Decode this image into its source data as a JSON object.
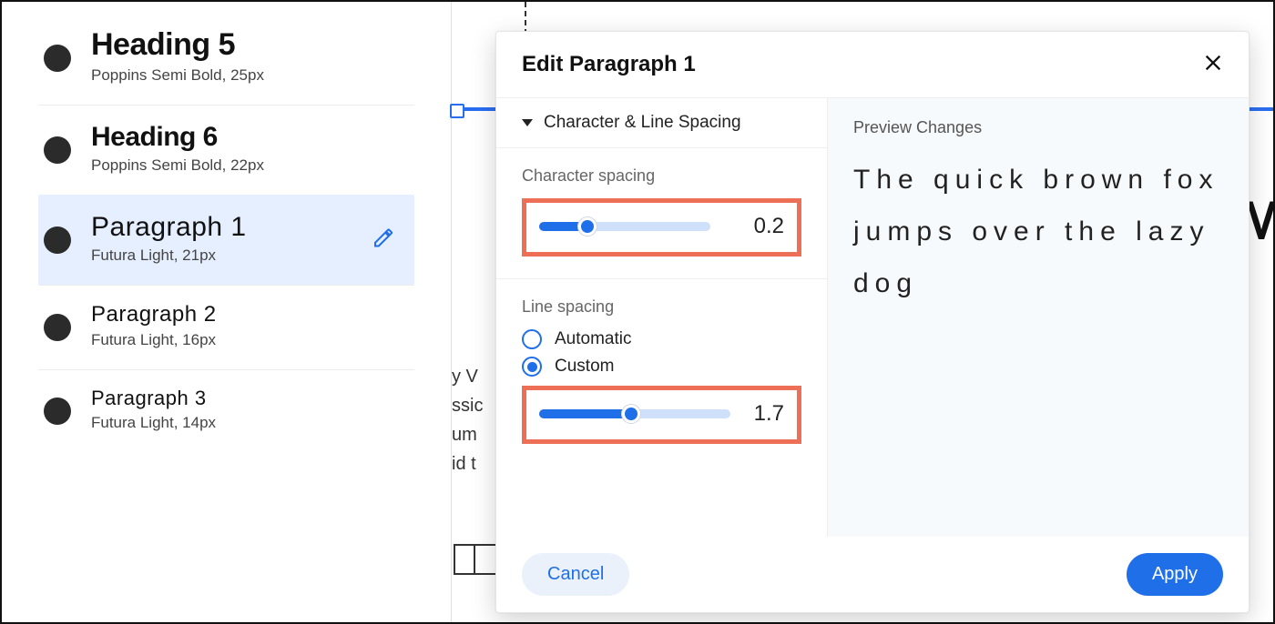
{
  "sidebar": {
    "items": [
      {
        "title": "Heading 5",
        "meta": "Poppins Semi Bold, 25px",
        "cls": "h5",
        "selected": false
      },
      {
        "title": "Heading 6",
        "meta": "Poppins Semi Bold, 22px",
        "cls": "h6",
        "selected": false
      },
      {
        "title": "Paragraph 1",
        "meta": "Futura Light, 21px",
        "cls": "p1",
        "selected": true
      },
      {
        "title": "Paragraph 2",
        "meta": "Futura Light, 16px",
        "cls": "p2",
        "selected": false
      },
      {
        "title": "Paragraph 3",
        "meta": "Futura Light, 14px",
        "cls": "p3",
        "selected": false
      }
    ]
  },
  "modal": {
    "title": "Edit Paragraph 1",
    "section": "Character & Line Spacing",
    "char_spacing": {
      "label": "Character spacing",
      "value": "0.2",
      "fill_pct": 28
    },
    "line_spacing": {
      "label": "Line spacing",
      "option_auto": "Automatic",
      "option_custom": "Custom",
      "selected": "custom",
      "value": "1.7",
      "fill_pct": 48
    },
    "preview_label": "Preview Changes",
    "preview_text": "The quick brown fox jumps over the lazy dog",
    "cancel": "Cancel",
    "apply": "Apply"
  },
  "background": {
    "big_letter": "M",
    "lorem": "y V\nssic\num\nid t"
  }
}
